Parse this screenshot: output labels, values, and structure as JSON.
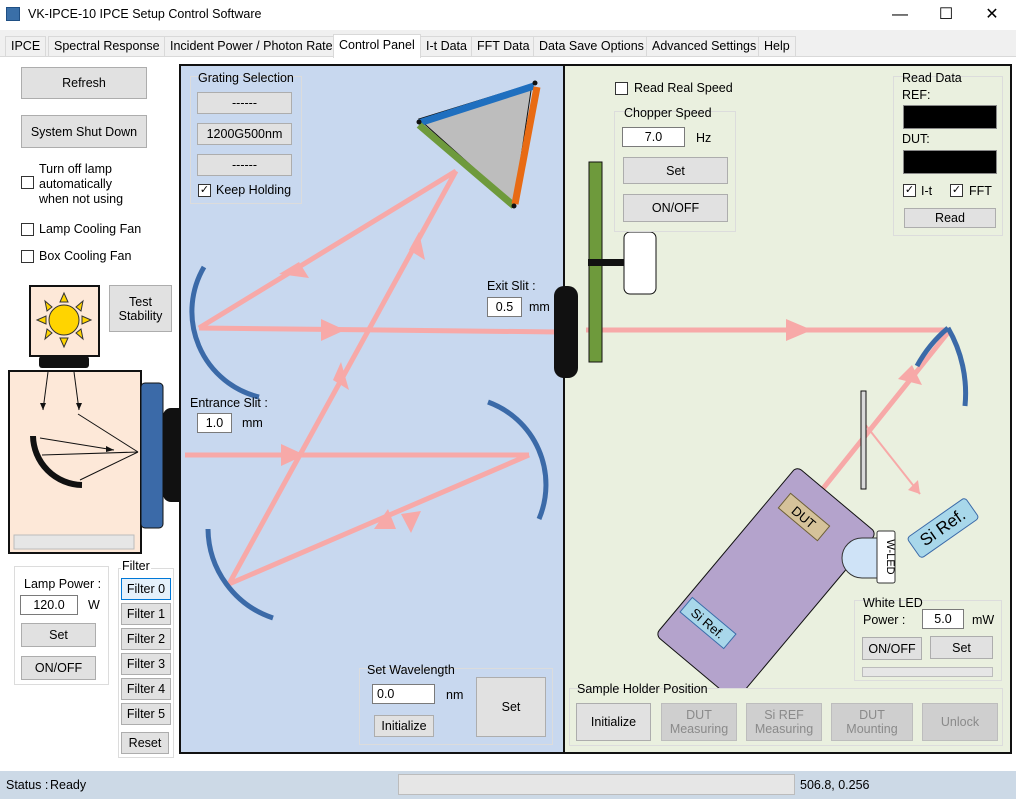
{
  "window": {
    "title": "VK-IPCE-10 IPCE Setup Control Software",
    "min": "—",
    "max": "☐",
    "close": "✕"
  },
  "tabs": [
    "IPCE",
    "Spectral Response",
    "Incident Power / Photon Rate",
    "Control Panel",
    "I-t Data",
    "FFT Data",
    "Data Save Options",
    "Advanced Settings",
    "Help"
  ],
  "active_tab": "Control Panel",
  "left": {
    "refresh": "Refresh",
    "shutdown": "System Shut Down",
    "turn_off_lamp": "Turn off lamp\nautomatically\nwhen not using",
    "lamp_fan": "Lamp Cooling Fan",
    "box_fan": "Box Cooling Fan",
    "test_stability": "Test\nStability",
    "lamp_power_label": "Lamp Power :",
    "lamp_power_value": "120.0",
    "lamp_power_unit": "W",
    "set": "Set",
    "onoff": "ON/OFF",
    "filter_title": "Filter",
    "filters": [
      "Filter 0",
      "Filter 1",
      "Filter 2",
      "Filter 3",
      "Filter 4",
      "Filter 5"
    ],
    "reset": "Reset"
  },
  "mono": {
    "grating_title": "Grating Selection",
    "grating_options": [
      "------",
      "1200G500nm",
      "------"
    ],
    "keep_holding": "Keep Holding",
    "keep_holding_checked": true,
    "exit_slit_label": "Exit Slit :",
    "exit_slit_value": "0.5",
    "entrance_slit_label": "Entrance Slit :",
    "entrance_slit_value": "1.0",
    "unit_mm": "mm",
    "set_wavelength_title": "Set Wavelength",
    "wavelength_value": "0.0",
    "wavelength_unit": "nm",
    "initialize": "Initialize",
    "set": "Set"
  },
  "sample": {
    "read_real_speed": "Read Real Speed",
    "chopper_title": "Chopper Speed",
    "chopper_value": "7.0",
    "chopper_unit": "Hz",
    "set": "Set",
    "onoff": "ON/OFF",
    "read_data_title": "Read Data",
    "ref_label": "REF:",
    "dut_label": "DUT:",
    "it_label": "I-t",
    "fft_label": "FFT",
    "it_checked": true,
    "fft_checked": true,
    "read": "Read",
    "dut_tag": "DUT",
    "siref_tag_big": "Si Ref.",
    "siref_tag_small": "Si Ref.",
    "wled_tag": "W-LED",
    "white_led_title": "White LED",
    "power_label": "Power :",
    "power_value": "5.0",
    "power_unit": "mW",
    "holder_title": "Sample Holder Position",
    "holder_buttons": [
      "Initialize",
      "DUT\nMeasuring",
      "Si REF\nMeasuring",
      "DUT\nMounting",
      "Unlock"
    ]
  },
  "status": {
    "label": "Status :",
    "value": "Ready",
    "coords": "506.8, 0.256"
  },
  "colors": {
    "beam": "#f7a9a8",
    "mono_bg": "#c8d8ef",
    "sample_bg": "#eaf0df",
    "mirror": "#3b6aa8",
    "grating": "#bdbdbd"
  }
}
